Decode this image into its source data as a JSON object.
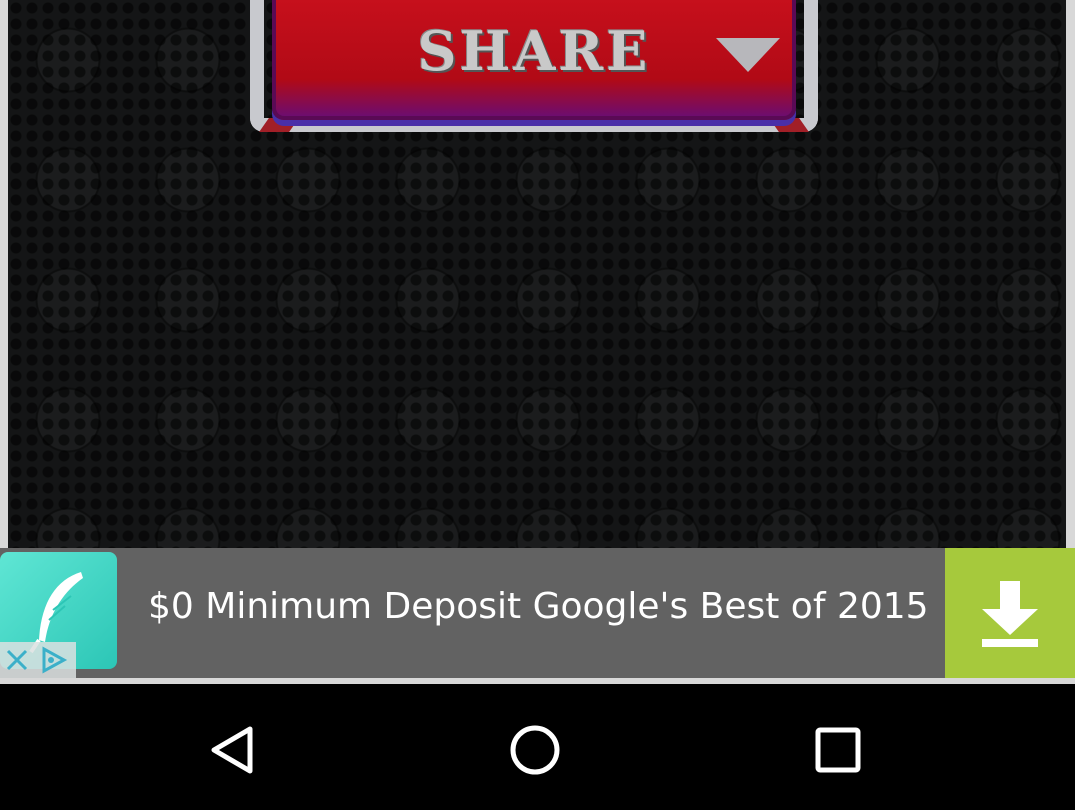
{
  "game": {
    "share_label": "SHARE"
  },
  "ad": {
    "headline": "$0 Minimum Deposit Google's Best of 2015",
    "icon": "feather-icon",
    "download_icon": "download-icon",
    "adchoices_icons": [
      "close-icon",
      "adchoices-icon"
    ]
  },
  "navbar": {
    "back_icon": "back-icon",
    "home_icon": "home-icon",
    "recents_icon": "recents-icon"
  },
  "colors": {
    "share_red": "#c8101c",
    "download_green": "#a6c93c",
    "ad_background": "#626262"
  }
}
